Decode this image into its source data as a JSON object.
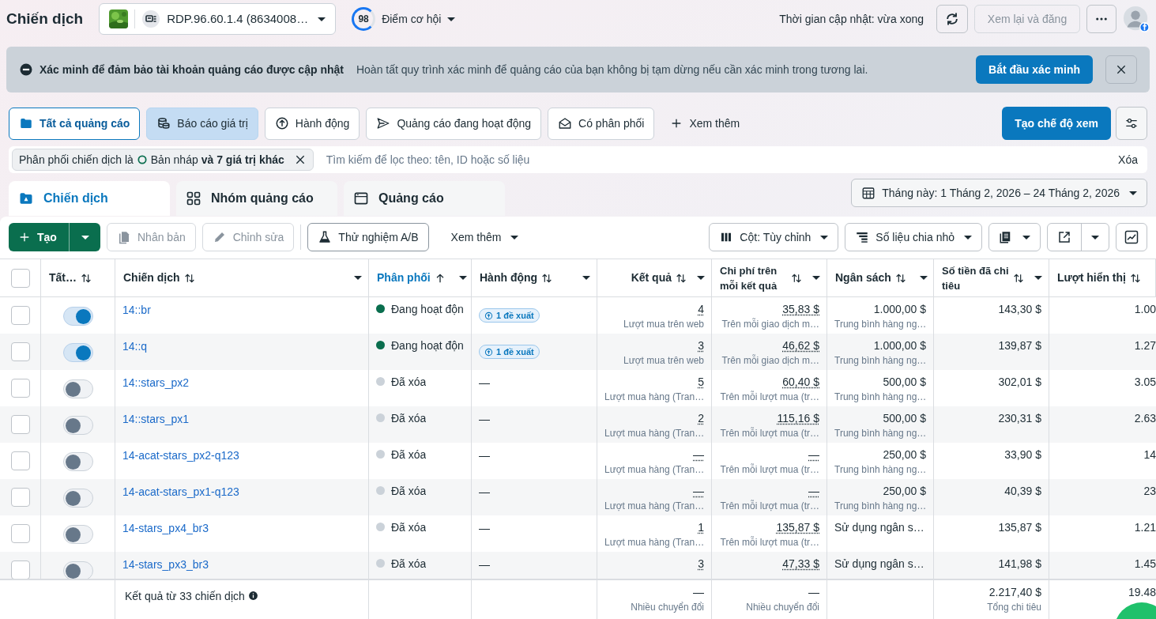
{
  "header": {
    "title": "Chiến dịch",
    "account": "RDP.96.60.1.4 (8634008…",
    "score": "98",
    "score_label": "Điểm cơ hội",
    "updated": "Thời gian cập nhật: vừa xong",
    "publish_button": {
      "label": "Xem lại và đăng",
      "disabled": true
    }
  },
  "banner": {
    "title": "Xác minh để đảm bảo tài khoản quảng cáo được cập nhật",
    "text": "Hoàn tất quy trình xác minh để quảng cáo của bạn không bị tạm dừng nếu cần xác minh trong tương lai.",
    "button": "Bắt đầu xác minh"
  },
  "views": [
    {
      "label": "Tất cả quảng cáo",
      "selected": true,
      "highlighted": false
    },
    {
      "label": "Báo cáo giá trị",
      "selected": false,
      "highlighted": true
    },
    {
      "label": "Hành động",
      "selected": false,
      "highlighted": false
    },
    {
      "label": "Quảng cáo đang hoạt động",
      "selected": false,
      "highlighted": false
    },
    {
      "label": "Có phân phối",
      "selected": false,
      "highlighted": false
    }
  ],
  "views_more": "Xem thêm",
  "create_view": "Tạo chế độ xem",
  "filter": {
    "chip": {
      "prefix": "Phân phối chiến dịch là",
      "value": "Bản nháp",
      "more": "và 7 giá trị khác"
    },
    "placeholder": "Tìm kiếm để lọc theo: tên, ID hoặc số liệu",
    "clear": "Xóa"
  },
  "level_tabs": [
    {
      "label": "Chiến dịch",
      "selected": true
    },
    {
      "label": "Nhóm quảng cáo",
      "selected": false
    },
    {
      "label": "Quảng cáo",
      "selected": false
    }
  ],
  "date_range": "Tháng này: 1 Tháng 2, 2026 – 24 Tháng 2, 2026",
  "toolbar": {
    "create": "Tạo",
    "actions": [
      {
        "label": "Nhân bản",
        "disabled": true
      },
      {
        "label": "Chỉnh sửa",
        "disabled": true
      },
      {
        "label": "Thử nghiệm A/B",
        "disabled": false
      }
    ],
    "more": "Xem thêm",
    "columns": "Cột: Tùy chỉnh",
    "breakdown": "Số liệu chia nhỏ"
  },
  "table": {
    "all_checked": false,
    "columns": [
      {
        "label": "Tất…",
        "sorted": false,
        "menu": false
      },
      {
        "label": "Chiến dịch",
        "sorted": false,
        "menu": true
      },
      {
        "label": "Phân phối",
        "sorted": true,
        "menu": true
      },
      {
        "label": "Hành động",
        "sorted": false,
        "menu": true
      },
      {
        "label": "Kết quả",
        "sorted": false,
        "menu": true
      },
      {
        "label": "Chi phí trên mỗi kết quả",
        "sorted": false,
        "menu": true
      },
      {
        "label": "Ngân sách",
        "sorted": false,
        "menu": true
      },
      {
        "label": "Số tiền đã chi tiêu",
        "sorted": false,
        "menu": true
      },
      {
        "label": "Lượt hiển thị",
        "sorted": false,
        "menu": false
      }
    ],
    "rows": [
      {
        "checked": false,
        "on": true,
        "name": "14::br",
        "delivery": "Đang hoạt độn",
        "color": "#0a6e4e",
        "action": {
          "kind": "badge",
          "text": "1 đề xuất"
        },
        "result": "4",
        "result_sub": "Lượt mua trên web",
        "cost": "35,83 $",
        "cost_sub": "Trên mỗi giao dịch m…",
        "budget": "1.000,00 $",
        "budget_sub": "Trung bình hàng ng…",
        "spent": "143,30 $",
        "impressions": "1.00"
      },
      {
        "checked": false,
        "on": true,
        "name": "14::q",
        "delivery": "Đang hoạt độn",
        "color": "#0a6e4e",
        "action": {
          "kind": "badge",
          "text": "1 đề xuất"
        },
        "result": "3",
        "result_sub": "Lượt mua trên web",
        "cost": "46,62 $",
        "cost_sub": "Trên mỗi giao dịch m…",
        "budget": "1.000,00 $",
        "budget_sub": "Trung bình hàng ng…",
        "spent": "139,87 $",
        "impressions": "1.27"
      },
      {
        "checked": false,
        "on": false,
        "name": "14::stars_px2",
        "delivery": "Đã xóa",
        "color": "#cbd2d9",
        "action": {
          "kind": "text",
          "text": "—"
        },
        "result": "5",
        "result_sub": "Lượt mua hàng (Tran…",
        "cost": "60,40 $",
        "cost_sub": "Trên mỗi lượt mua (tr…",
        "budget": "500,00 $",
        "budget_sub": "Trung bình hàng ng…",
        "spent": "302,01 $",
        "impressions": "3.05"
      },
      {
        "checked": false,
        "on": false,
        "name": "14::stars_px1",
        "delivery": "Đã xóa",
        "color": "#cbd2d9",
        "action": {
          "kind": "text",
          "text": "—"
        },
        "result": "2",
        "result_sub": "Lượt mua hàng (Tran…",
        "cost": "115,16 $",
        "cost_sub": "Trên mỗi lượt mua (tr…",
        "budget": "500,00 $",
        "budget_sub": "Trung bình hàng ng…",
        "spent": "230,31 $",
        "impressions": "2.63"
      },
      {
        "checked": false,
        "on": false,
        "name": "14-acat-stars_px2-q123",
        "delivery": "Đã xóa",
        "color": "#cbd2d9",
        "action": {
          "kind": "text",
          "text": "—"
        },
        "result": "—",
        "result_sub": "Lượt mua hàng (Tran…",
        "cost": "—",
        "cost_sub": "Trên mỗi lượt mua (tr…",
        "budget": "250,00 $",
        "budget_sub": "Trung bình hàng ng…",
        "spent": "33,90 $",
        "impressions": "14"
      },
      {
        "checked": false,
        "on": false,
        "name": "14-acat-stars_px1-q123",
        "delivery": "Đã xóa",
        "color": "#cbd2d9",
        "action": {
          "kind": "text",
          "text": "—"
        },
        "result": "—",
        "result_sub": "Lượt mua hàng (Tran…",
        "cost": "—",
        "cost_sub": "Trên mỗi lượt mua (tr…",
        "budget": "250,00 $",
        "budget_sub": "Trung bình hàng ng…",
        "spent": "40,39 $",
        "impressions": "23"
      },
      {
        "checked": false,
        "on": false,
        "name": "14-stars_px4_br3",
        "delivery": "Đã xóa",
        "color": "#cbd2d9",
        "action": {
          "kind": "text",
          "text": "—"
        },
        "result": "1",
        "result_sub": "Lượt mua hàng (Tran…",
        "cost": "135,87 $",
        "cost_sub": "Trên mỗi lượt mua (tr…",
        "budget": "Sử dụng ngân s…",
        "spent": "135,87 $",
        "impressions": "1.21"
      },
      {
        "checked": false,
        "on": false,
        "name": "14-stars_px3_br3",
        "delivery": "Đã xóa",
        "color": "#cbd2d9",
        "action": {
          "kind": "text",
          "text": "—"
        },
        "result": "3",
        "cost": "47,33 $",
        "budget": "Sử dụng ngân s…",
        "spent": "141,98 $",
        "impressions": "1.45"
      }
    ],
    "footer": {
      "summary": "Kết quả từ 33 chiến dịch",
      "result": "—",
      "result_sub": "Nhiều chuyển đổi",
      "cost": "—",
      "cost_sub": "Nhiều chuyển đổi",
      "spent": "2.217,40 $",
      "spent_sub": "Tổng chi tiêu",
      "impressions": "19.48"
    }
  }
}
